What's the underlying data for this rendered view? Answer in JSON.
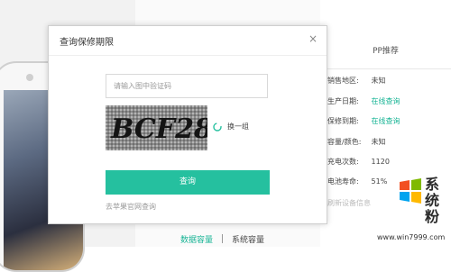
{
  "modal": {
    "title": "查询保修期限",
    "close_glyph": "×",
    "captcha_placeholder": "请输入图中验证码",
    "captcha_text": "BCF28",
    "refresh_label": "换一组",
    "submit_label": "查询",
    "apple_link": "去苹果官网查询"
  },
  "right_panel": {
    "header": "PP推荐",
    "rows": [
      {
        "label": "销售地区:",
        "value": "未知"
      },
      {
        "label": "生产日期:",
        "value": "在线查询"
      },
      {
        "label": "保修到期:",
        "value": "在线查询"
      },
      {
        "label": "容量/颜色:",
        "value": "未知"
      },
      {
        "label": "充电次数:",
        "value": "1120"
      },
      {
        "label": "电池寿命:",
        "value": "51%"
      },
      {
        "label": "刷新设备信息",
        "value": ""
      }
    ]
  },
  "footer_tabs": {
    "active": "数据容量",
    "other": "系统容量"
  },
  "watermark": {
    "name": "系统粉",
    "url": "www.win7999.com"
  },
  "colors": {
    "accent": "#25c09f",
    "link": "#18b495"
  }
}
